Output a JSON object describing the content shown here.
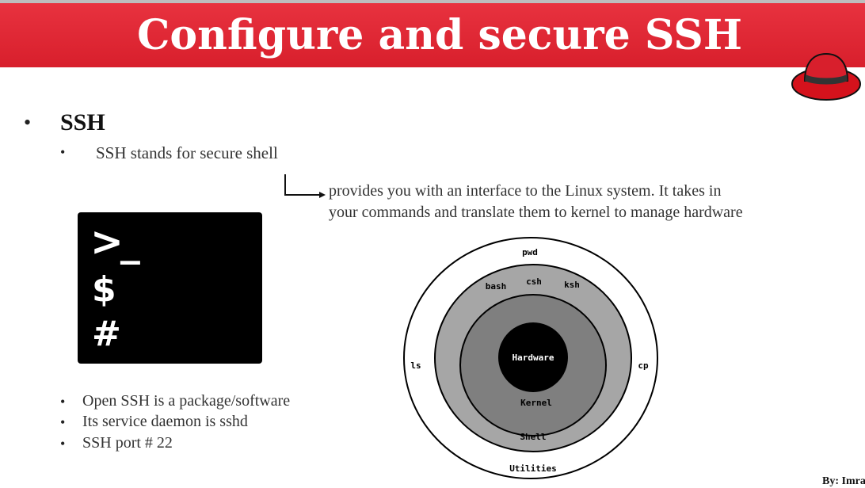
{
  "header": {
    "title": "Configure and secure SSH",
    "banner_color": "#e02a36",
    "logo_icon": "red-fedora-hat-icon"
  },
  "section": {
    "heading": "SSH",
    "definition": "SSH stands for secure shell",
    "shell_description_line1": "provides you with an interface to the Linux system.  It takes in",
    "shell_description_line2": "your commands and translate them to kernel to manage hardware"
  },
  "terminal_icon": {
    "prompt": ">_",
    "dollar": "$",
    "hash": "#"
  },
  "facts": [
    "Open SSH is a package/software",
    "Its service daemon is sshd",
    "SSH port # 22"
  ],
  "layers_diagram": {
    "utilities_ring": {
      "label": "Utilities",
      "commands": [
        "pwd",
        "ls",
        "cp"
      ],
      "color": "#ffffff"
    },
    "shell_ring": {
      "label": "Shell",
      "shells": [
        "bash",
        "csh",
        "ksh"
      ],
      "color": "#a6a6a6"
    },
    "kernel_ring": {
      "label": "Kernel",
      "color": "#7f7f7f"
    },
    "core": {
      "label": "Hardware",
      "color": "#000000"
    }
  },
  "footer": {
    "credit": "By: Imran"
  }
}
